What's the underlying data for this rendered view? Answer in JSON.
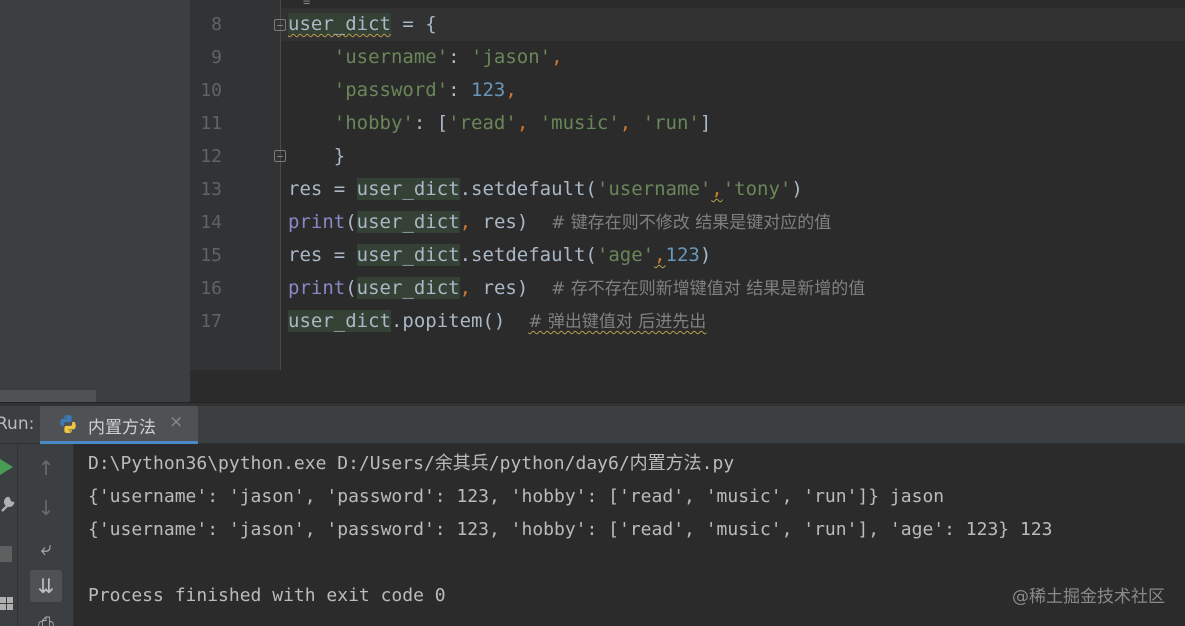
{
  "editor": {
    "lines": [
      {
        "num": "8",
        "tokens": [
          {
            "t": "user_dict",
            "c": "hl-var squiggle"
          },
          {
            "t": " = {",
            "c": ""
          }
        ]
      },
      {
        "num": "9",
        "tokens": [
          {
            "t": "    ",
            "c": ""
          },
          {
            "t": "'username'",
            "c": "str"
          },
          {
            "t": ": ",
            "c": ""
          },
          {
            "t": "'jason'",
            "c": "str"
          },
          {
            "t": ",",
            "c": "punc"
          }
        ]
      },
      {
        "num": "10",
        "tokens": [
          {
            "t": "    ",
            "c": ""
          },
          {
            "t": "'password'",
            "c": "str"
          },
          {
            "t": ": ",
            "c": ""
          },
          {
            "t": "123",
            "c": "num"
          },
          {
            "t": ",",
            "c": "punc"
          }
        ]
      },
      {
        "num": "11",
        "tokens": [
          {
            "t": "    ",
            "c": ""
          },
          {
            "t": "'hobby'",
            "c": "str"
          },
          {
            "t": ": [",
            "c": ""
          },
          {
            "t": "'read'",
            "c": "str"
          },
          {
            "t": ", ",
            "c": "punc"
          },
          {
            "t": "'music'",
            "c": "str"
          },
          {
            "t": ", ",
            "c": "punc"
          },
          {
            "t": "'run'",
            "c": "str"
          },
          {
            "t": "]",
            "c": ""
          }
        ]
      },
      {
        "num": "12",
        "tokens": [
          {
            "t": "    }",
            "c": ""
          }
        ]
      },
      {
        "num": "13",
        "tokens": [
          {
            "t": "res = ",
            "c": ""
          },
          {
            "t": "user_dict",
            "c": "hl-var"
          },
          {
            "t": ".setdefault(",
            "c": ""
          },
          {
            "t": "'username'",
            "c": "str"
          },
          {
            "t": ",",
            "c": "punc squiggle"
          },
          {
            "t": "'tony'",
            "c": "str"
          },
          {
            "t": ")",
            "c": ""
          }
        ]
      },
      {
        "num": "14",
        "tokens": [
          {
            "t": "print",
            "c": "builtin"
          },
          {
            "t": "(",
            "c": ""
          },
          {
            "t": "user_dict",
            "c": "hl-var"
          },
          {
            "t": ", ",
            "c": "punc"
          },
          {
            "t": "res)  ",
            "c": ""
          },
          {
            "t": "# 键存在则不修改 结果是键对应的值",
            "c": "comment"
          }
        ]
      },
      {
        "num": "15",
        "tokens": [
          {
            "t": "res = ",
            "c": ""
          },
          {
            "t": "user_dict",
            "c": "hl-var"
          },
          {
            "t": ".setdefault(",
            "c": ""
          },
          {
            "t": "'age'",
            "c": "str"
          },
          {
            "t": ",",
            "c": "punc squiggle"
          },
          {
            "t": "123",
            "c": "num"
          },
          {
            "t": ")",
            "c": ""
          }
        ]
      },
      {
        "num": "16",
        "tokens": [
          {
            "t": "print",
            "c": "builtin"
          },
          {
            "t": "(",
            "c": ""
          },
          {
            "t": "user_dict",
            "c": "hl-var"
          },
          {
            "t": ", ",
            "c": "punc"
          },
          {
            "t": "res)  ",
            "c": ""
          },
          {
            "t": "# 存不存在则新增键值对 结果是新增的值",
            "c": "comment"
          }
        ]
      },
      {
        "num": "17",
        "tokens": [
          {
            "t": "user_dict",
            "c": "hl-var"
          },
          {
            "t": ".popitem()  ",
            "c": ""
          },
          {
            "t": "# 弹出键值对 后进先出",
            "c": "comment squiggle"
          }
        ]
      }
    ]
  },
  "run": {
    "label": "Run:",
    "tab_title": "内置方法",
    "close_glyph": "×",
    "output": [
      "D:\\Python36\\python.exe D:/Users/余其兵/python/day6/内置方法.py",
      "{'username': 'jason', 'password': 123, 'hobby': ['read', 'music', 'run']} jason",
      "{'username': 'jason', 'password': 123, 'hobby': ['read', 'music', 'run'], 'age': 123} 123",
      "",
      "Process finished with exit code 0"
    ]
  },
  "watermark": "@稀土掘金技术社区",
  "colors": {
    "editor_bg": "#2b2b2b",
    "string": "#6a8759",
    "number": "#6897bb",
    "keyword_punct": "#cc7832",
    "builtin": "#8888c6",
    "comment": "#808080",
    "run_green": "#499c54",
    "tab_underline": "#4a88c7"
  },
  "icons": [
    "python-file-icon",
    "close-icon",
    "run-play-icon",
    "wrench-icon",
    "stop-icon",
    "layout-icon",
    "arrow-up-icon",
    "arrow-down-icon",
    "soft-wrap-icon",
    "scroll-to-end-icon",
    "print-icon"
  ]
}
